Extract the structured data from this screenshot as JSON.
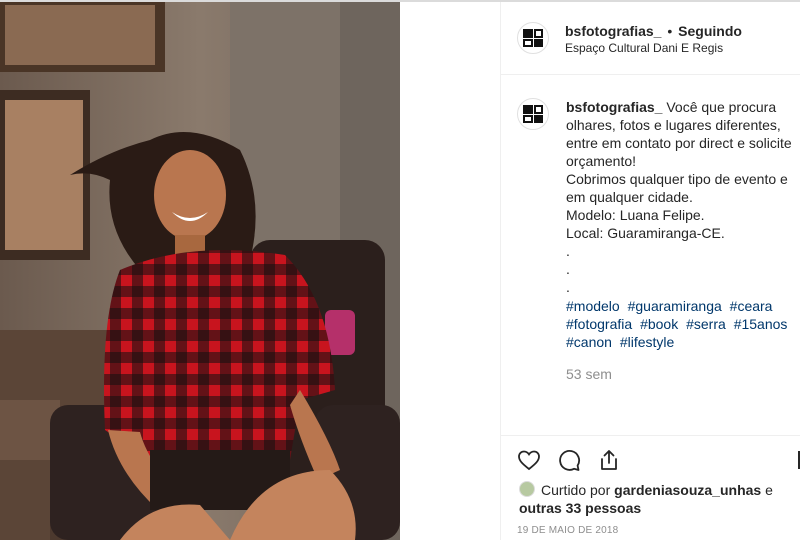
{
  "header": {
    "username": "bsfotografias_",
    "separator": "•",
    "follow_status": "Seguindo",
    "location": "Espaço Cultural Dani E Regis"
  },
  "caption": {
    "username": "bsfotografias_",
    "lines": [
      "Você que procura",
      "olhares, fotos e lugares diferentes,",
      "entre em contato por direct e solicite",
      "orçamento!",
      "Cobrimos qualquer tipo de evento e",
      "em qualquer cidade.",
      "Modelo: Luana Felipe.",
      "Local: Guaramiranga-CE.",
      ".",
      ".",
      "."
    ],
    "hashtags": [
      "#modelo",
      "#guaramiranga",
      "#ceara",
      "#fotografia",
      "#book",
      "#serra",
      "#15anos",
      "#canon",
      "#lifestyle"
    ],
    "time_ago": "53 sem"
  },
  "actions": {
    "like_icon": "heart-icon",
    "comment_icon": "comment-icon",
    "share_icon": "share-icon",
    "save_icon": "bookmark-icon"
  },
  "likes": {
    "prefix": "Curtido por",
    "user": "gardeniasouza_unhas",
    "connector": "e",
    "others": "outras 33 pessoas"
  },
  "date": "19 DE MAIO DE 2018",
  "colors": {
    "hashtag": "#00376b",
    "muted": "#8e8e8e",
    "text": "#262626",
    "shirt_red": "#c0121c"
  }
}
